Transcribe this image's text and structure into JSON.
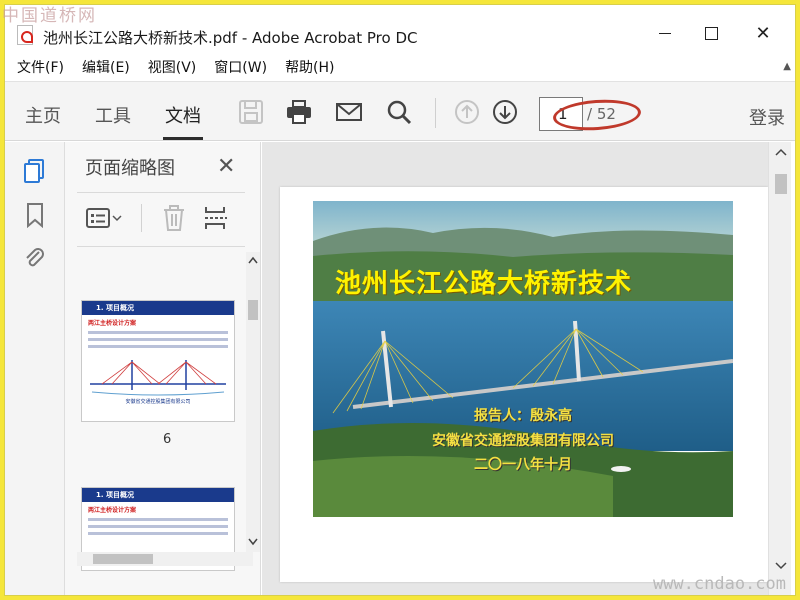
{
  "watermarks": {
    "top_left": "中国道桥网",
    "bottom_right": "www.cndao.com"
  },
  "window": {
    "title": "池州长江公路大桥新技术.pdf - Adobe Acrobat Pro DC",
    "close_glyph": "✕"
  },
  "menu": {
    "items": [
      "文件(F)",
      "编辑(E)",
      "视图(V)",
      "窗口(W)",
      "帮助(H)"
    ],
    "overflow": "▲"
  },
  "toolbar": {
    "tabs": [
      "主页",
      "工具",
      "文档"
    ],
    "active_tab": "文档",
    "page_current": "1",
    "page_total": "/ 52",
    "login": "登录",
    "icons": [
      "save-icon",
      "print-icon",
      "email-icon",
      "search-icon",
      "page-up-icon",
      "page-down-icon"
    ]
  },
  "thumbnails_panel": {
    "title": "页面缩略图",
    "close_glyph": "✕",
    "thumbs": [
      {
        "page_label": "6",
        "header": "1. 项目概况",
        "sub": "两江主桥设计方案",
        "footer": "安徽省交通控股集团有限公司"
      },
      {
        "page_label": "",
        "header": "1. 项目概况",
        "sub": "两江主桥设计方案"
      }
    ]
  },
  "slide": {
    "title": "池州长江公路大桥新技术",
    "reporter": "报告人：殷永高",
    "org": "安徽省交通控股集团有限公司",
    "date": "二〇一八年十月"
  },
  "colors": {
    "accent": "#2d7ad6",
    "annotation": "#c0392b",
    "slide_text": "#fff200"
  }
}
